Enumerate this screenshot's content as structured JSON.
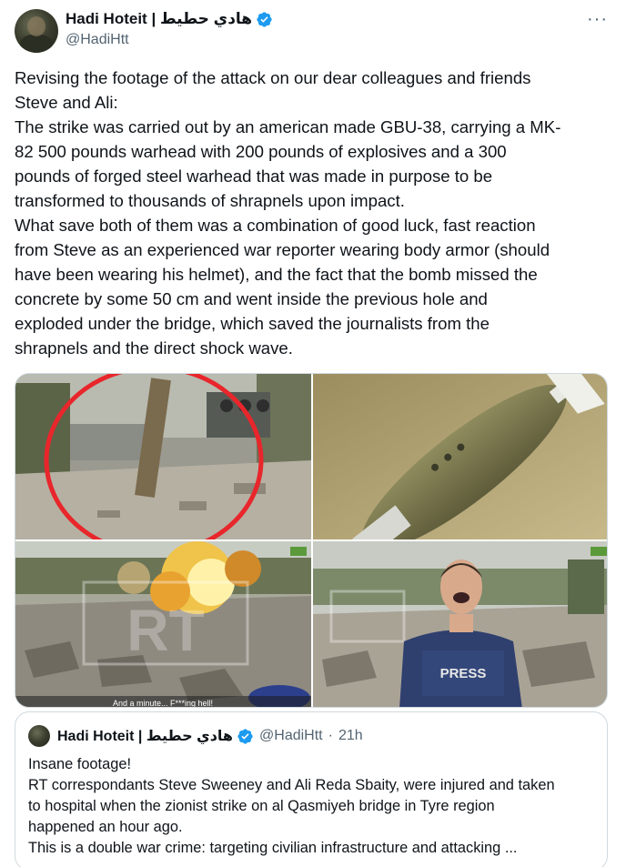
{
  "author": {
    "display_name": "Hadi Hoteit | هادي حطيط",
    "handle": "@HadiHtt"
  },
  "more_icon_glyph": "···",
  "tweet": {
    "text": "Revising the footage of the attack on our dear colleagues and friends\nSteve and Ali:\nThe strike was carried out by an american made GBU-38, carrying a MK-\n82 500 pounds warhead with 200 pounds of explosives and a 300\npounds of forged steel warhead that was made in purpose to be\ntransformed to thousands of shrapnels upon impact.\nWhat save both of them was a combination of good luck, fast reaction\nfrom Steve as an experienced war reporter wearing body armor (should\nhave been wearing his helmet), and the fact that the bomb missed the\nconcrete by some 50 cm and went inside the previous hole and\nexploded under the bridge, which saved the journalists from the\nshrapnels and the direct shock wave."
  },
  "media": {
    "watermark_rt": "RT",
    "vest_label": "PRESS",
    "caption": "And a minute... F***ing hell!"
  },
  "quote": {
    "display_name": "Hadi Hoteit | هادي حطيط",
    "handle": "@HadiHtt",
    "separator": "·",
    "time": "21h",
    "text": "Insane footage!\nRT correspondants Steve Sweeney and Ali Reda Sbaity, were injured and taken\nto hospital when the zionist strike on al Qasmiyeh bridge in Tyre region\nhappened an hour ago.\nThis is a double war crime: targeting civilian infrastructure and attacking ..."
  },
  "colors": {
    "verified_blue": "#1d9bf0",
    "text": "#0f1419",
    "secondary": "#536471",
    "border": "#cfd9de",
    "circle_red": "#e8262b"
  },
  "icons": {
    "verified": "verified-badge-icon",
    "more": "more-options-icon"
  }
}
